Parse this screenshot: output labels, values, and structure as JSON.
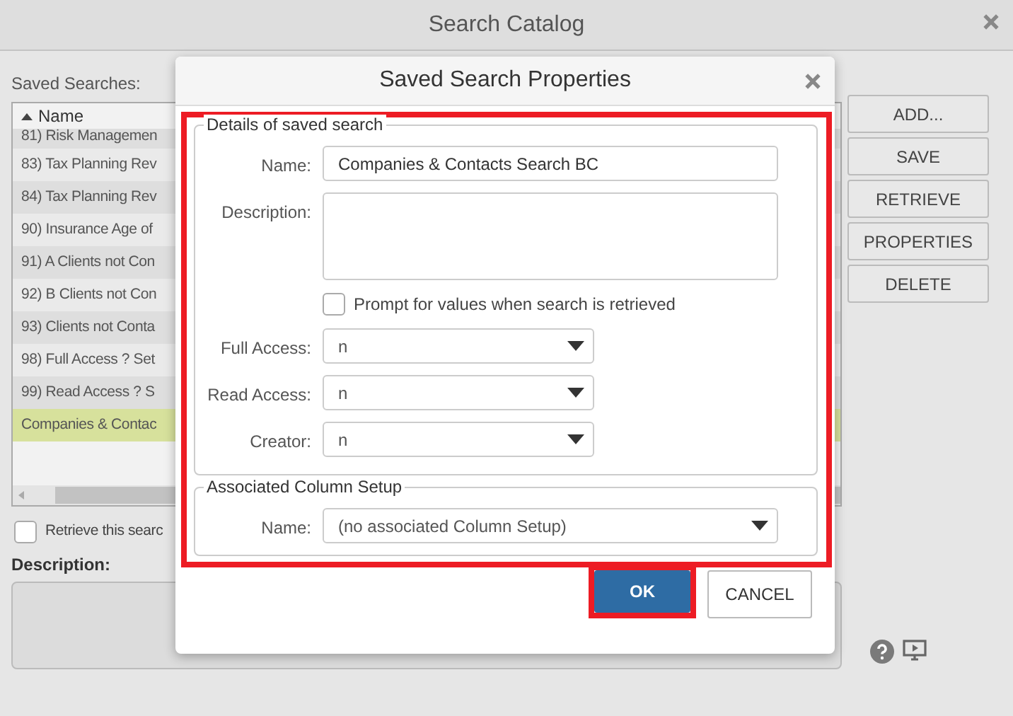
{
  "window": {
    "title": "Search Catalog"
  },
  "saved_searches": {
    "label": "Saved Searches:",
    "column": "Name",
    "rows": [
      {
        "text": "81) Risk Managemen",
        "selected": false
      },
      {
        "text": "83) Tax Planning Rev",
        "selected": false
      },
      {
        "text": "84) Tax Planning Rev",
        "selected": false
      },
      {
        "text": "90) Insurance Age of",
        "selected": false
      },
      {
        "text": "91) A Clients not Con",
        "selected": false
      },
      {
        "text": "92) B Clients not Con",
        "selected": false
      },
      {
        "text": "93) Clients not Conta",
        "selected": false
      },
      {
        "text": "98) Full Access ? Set",
        "selected": false
      },
      {
        "text": "99) Read Access ? S",
        "selected": false
      },
      {
        "text": "Companies & Contac",
        "selected": true
      }
    ]
  },
  "retrieve_option": {
    "label": "Retrieve this searc",
    "checked": false
  },
  "description": {
    "label": "Description:"
  },
  "buttons": [
    "ADD...",
    "SAVE",
    "RETRIEVE",
    "PROPERTIES",
    "DELETE"
  ],
  "dialog": {
    "title": "Saved Search Properties",
    "highlighted": true,
    "details": {
      "legend": "Details of saved search",
      "name": {
        "label": "Name:",
        "value": "Companies & Contacts Search BC"
      },
      "description": {
        "label": "Description:"
      },
      "prompt": {
        "label": "Prompt for values when search is retrieved",
        "checked": false
      },
      "selects": [
        {
          "label": "Full Access:",
          "value": "n"
        },
        {
          "label": "Read Access:",
          "value": "n"
        },
        {
          "label": "Creator:",
          "value": "n"
        }
      ]
    },
    "column_setup": {
      "legend": "Associated Column Setup",
      "name": {
        "label": "Name:",
        "value": "(no associated Column Setup)"
      }
    },
    "buttons": [
      {
        "label": "OK",
        "kind": "primary",
        "highlighted": true
      },
      {
        "label": "CANCEL",
        "kind": "secondary",
        "highlighted": false
      }
    ]
  }
}
